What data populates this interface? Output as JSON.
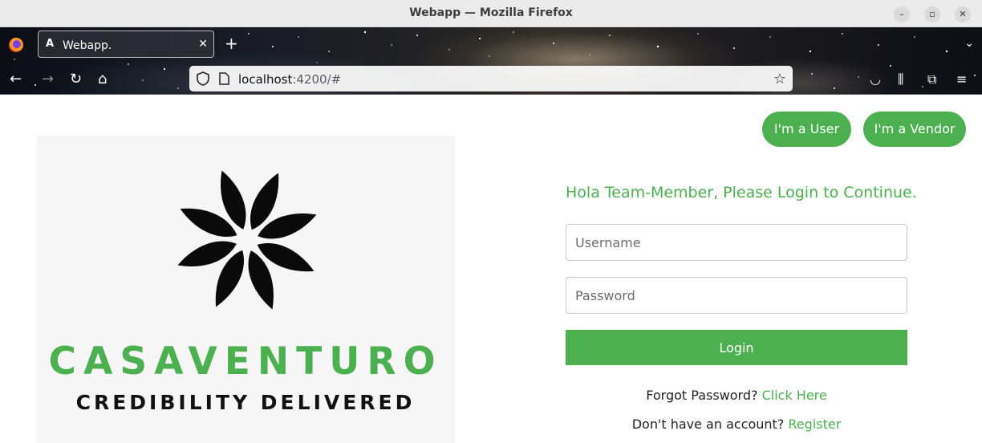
{
  "window": {
    "title": "Webapp — Mozilla Firefox"
  },
  "browser": {
    "tab_label": "Webapp.",
    "tab_favicon": "A",
    "url_host": "localhost",
    "url_rest": ":4200/#"
  },
  "header": {
    "user_button": "I'm a User",
    "vendor_button": "I'm a Vendor"
  },
  "brand": {
    "name": "CASAVENTURO",
    "tagline": "CREDIBILITY DELIVERED",
    "accent_color": "#4caf50"
  },
  "login": {
    "greeting": "Hola Team-Member, Please Login to Continue.",
    "username_placeholder": "Username",
    "password_placeholder": "Password",
    "submit_label": "Login",
    "forgot_prefix": "Forgot Password? ",
    "forgot_link": "Click Here",
    "register_prefix": "Don't have an account? ",
    "register_link": "Register"
  }
}
